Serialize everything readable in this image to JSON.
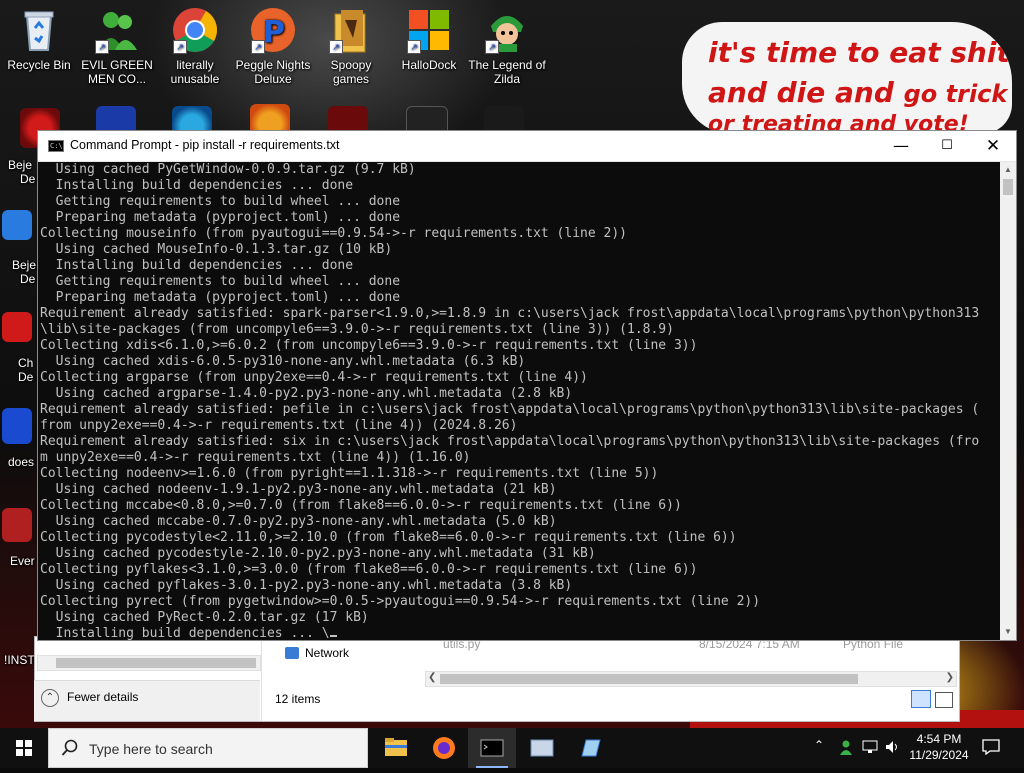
{
  "desktop": {
    "icons": [
      {
        "label": "Recycle Bin",
        "icon": "recycle-bin-icon"
      },
      {
        "label": "EVIL GREEN MEN CO...",
        "icon": "green-men-icon"
      },
      {
        "label": "literally unusable",
        "icon": "chrome-icon"
      },
      {
        "label": "Peggle Nights Deluxe",
        "icon": "peggle-icon"
      },
      {
        "label": "Spoopy games",
        "icon": "folder-icon"
      },
      {
        "label": "HalloDock",
        "icon": "windows-logo-icon"
      },
      {
        "label": "The Legend of Zilda",
        "icon": "zelda-icon"
      }
    ],
    "side_labels": [
      "Beje",
      "De",
      "Beje",
      "De",
      "Ch",
      "De",
      "does",
      "Ever",
      "!INST"
    ],
    "meme": {
      "line1": "it's time to eat shit",
      "line2a": "and die and",
      "line2b": "go trick",
      "line3": "or treating and vote!"
    }
  },
  "cmd": {
    "title": "Command Prompt - pip  install -r requirements.txt",
    "icon_text": "C:\\",
    "lines": [
      "  Using cached PyGetWindow-0.0.9.tar.gz (9.7 kB)",
      "  Installing build dependencies ... done",
      "  Getting requirements to build wheel ... done",
      "  Preparing metadata (pyproject.toml) ... done",
      "Collecting mouseinfo (from pyautogui==0.9.54->-r requirements.txt (line 2))",
      "  Using cached MouseInfo-0.1.3.tar.gz (10 kB)",
      "  Installing build dependencies ... done",
      "  Getting requirements to build wheel ... done",
      "  Preparing metadata (pyproject.toml) ... done",
      "Requirement already satisfied: spark-parser<1.9.0,>=1.8.9 in c:\\users\\jack frost\\appdata\\local\\programs\\python\\python313",
      "\\lib\\site-packages (from uncompyle6==3.9.0->-r requirements.txt (line 3)) (1.8.9)",
      "Collecting xdis<6.1.0,>=6.0.2 (from uncompyle6==3.9.0->-r requirements.txt (line 3))",
      "  Using cached xdis-6.0.5-py310-none-any.whl.metadata (6.3 kB)",
      "Collecting argparse (from unpy2exe==0.4->-r requirements.txt (line 4))",
      "  Using cached argparse-1.4.0-py2.py3-none-any.whl.metadata (2.8 kB)",
      "Requirement already satisfied: pefile in c:\\users\\jack frost\\appdata\\local\\programs\\python\\python313\\lib\\site-packages (",
      "from unpy2exe==0.4->-r requirements.txt (line 4)) (2024.8.26)",
      "Requirement already satisfied: six in c:\\users\\jack frost\\appdata\\local\\programs\\python\\python313\\lib\\site-packages (fro",
      "m unpy2exe==0.4->-r requirements.txt (line 4)) (1.16.0)",
      "Collecting nodeenv>=1.6.0 (from pyright==1.1.318->-r requirements.txt (line 5))",
      "  Using cached nodeenv-1.9.1-py2.py3-none-any.whl.metadata (21 kB)",
      "Collecting mccabe<0.8.0,>=0.7.0 (from flake8==6.0.0->-r requirements.txt (line 6))",
      "  Using cached mccabe-0.7.0-py2.py3-none-any.whl.metadata (5.0 kB)",
      "Collecting pycodestyle<2.11.0,>=2.10.0 (from flake8==6.0.0->-r requirements.txt (line 6))",
      "  Using cached pycodestyle-2.10.0-py2.py3-none-any.whl.metadata (31 kB)",
      "Collecting pyflakes<3.1.0,>=3.0.0 (from flake8==6.0.0->-r requirements.txt (line 6))",
      "  Using cached pyflakes-3.0.1-py2.py3-none-any.whl.metadata (3.8 kB)",
      "Collecting pyrect (from pygetwindow>=0.0.5->pyautogui==0.9.54->-r requirements.txt (line 2))",
      "  Using cached PyRect-0.2.0.tar.gz (17 kB)",
      "  Installing build dependencies ... \\"
    ]
  },
  "explorer": {
    "nav_item": "Network",
    "file_name": "utils.py",
    "file_date": "8/15/2024 7:15 AM",
    "file_type": "Python File",
    "item_count": "12 items",
    "fewer_details": "Fewer details"
  },
  "taskbar": {
    "search_placeholder": "Type here to search",
    "time": "4:54 PM",
    "date": "11/29/2024"
  }
}
